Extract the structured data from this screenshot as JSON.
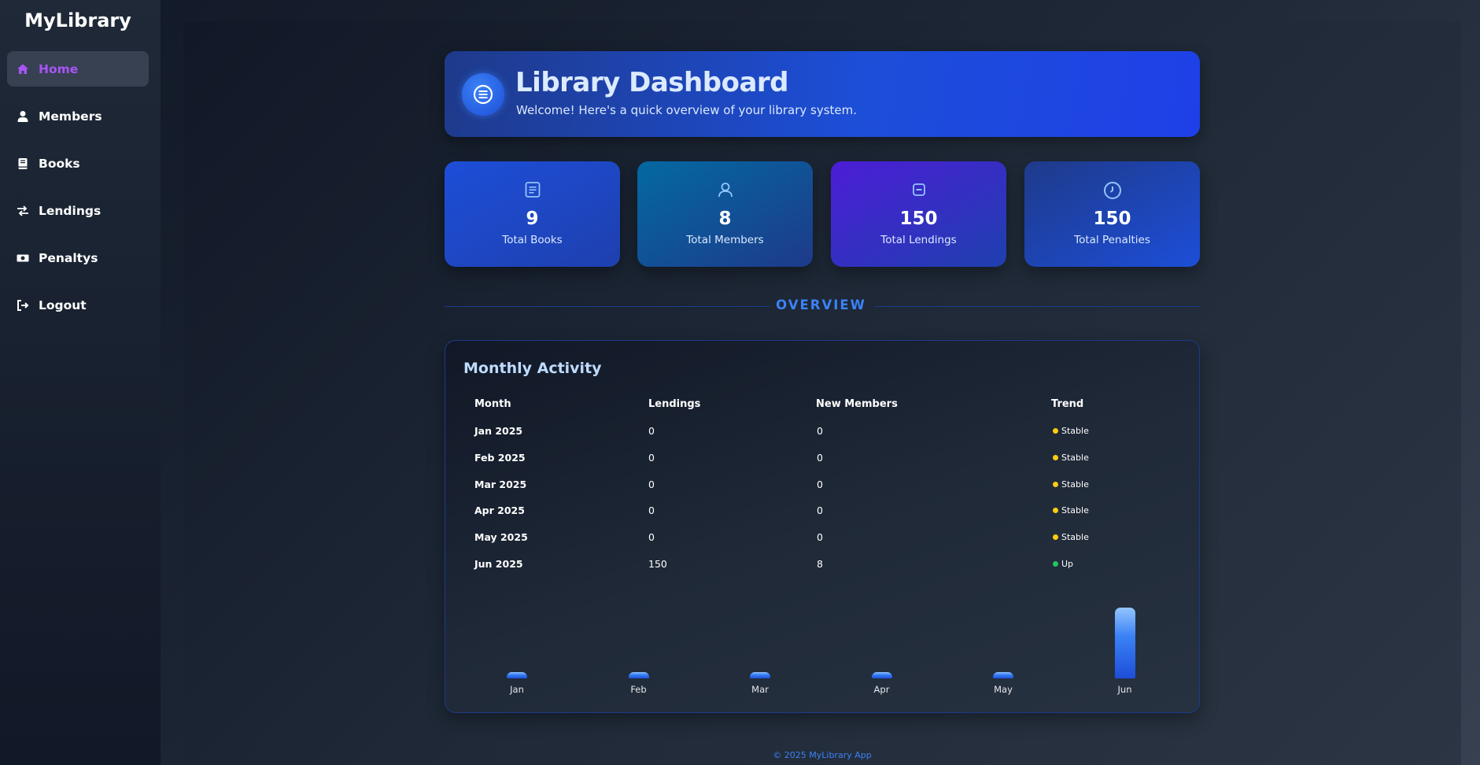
{
  "app": {
    "brand": "MyLibrary"
  },
  "nav": [
    {
      "label": "Home",
      "icon": "home-icon",
      "active": true
    },
    {
      "label": "Members",
      "icon": "user-icon"
    },
    {
      "label": "Books",
      "icon": "book-icon"
    },
    {
      "label": "Lendings",
      "icon": "exchange-icon"
    },
    {
      "label": "Penaltys",
      "icon": "money-icon"
    },
    {
      "label": "Logout",
      "icon": "logout-icon"
    }
  ],
  "header": {
    "title": "Library Dashboard",
    "subtitle": "Welcome! Here's a quick overview of your library system.",
    "icon": "list-circle-icon"
  },
  "stats": [
    {
      "value": "9",
      "label": "Total Books",
      "icon": "document-icon"
    },
    {
      "value": "8",
      "label": "Total Members",
      "icon": "user-icon"
    },
    {
      "value": "150",
      "label": "Total Lendings",
      "icon": "minus-square-icon"
    },
    {
      "value": "150",
      "label": "Total Penalties",
      "icon": "clock-icon"
    }
  ],
  "overview_label": "OVERVIEW",
  "activity": {
    "title": "Monthly Activity",
    "columns": [
      "Month",
      "Lendings",
      "New Members",
      "Trend"
    ],
    "rows": [
      {
        "month": "Jan 2025",
        "lendings": "0",
        "new_members": "0",
        "trend": "Stable"
      },
      {
        "month": "Feb 2025",
        "lendings": "0",
        "new_members": "0",
        "trend": "Stable"
      },
      {
        "month": "Mar 2025",
        "lendings": "0",
        "new_members": "0",
        "trend": "Stable"
      },
      {
        "month": "Apr 2025",
        "lendings": "0",
        "new_members": "0",
        "trend": "Stable"
      },
      {
        "month": "May 2025",
        "lendings": "0",
        "new_members": "0",
        "trend": "Stable"
      },
      {
        "month": "Jun 2025",
        "lendings": "150",
        "new_members": "8",
        "trend": "Up"
      }
    ]
  },
  "colors": {
    "accent": "#a855f7",
    "trend_stable": "#facc15",
    "trend_up": "#22c55e",
    "primary_blue": "#1d4ed8"
  },
  "chart_data": {
    "type": "bar",
    "categories": [
      "Jan",
      "Feb",
      "Mar",
      "Apr",
      "May",
      "Jun"
    ],
    "values": [
      0,
      0,
      0,
      0,
      0,
      150
    ]
  },
  "footer": {
    "text": "© 2025 MyLibrary App"
  }
}
